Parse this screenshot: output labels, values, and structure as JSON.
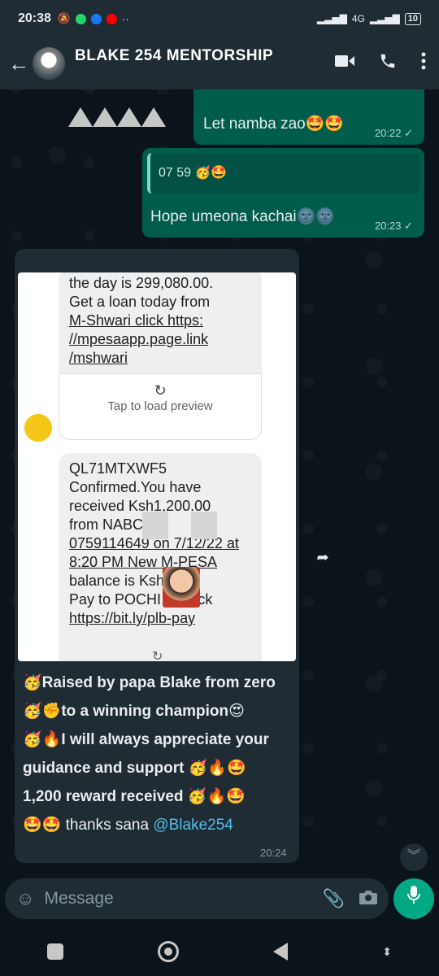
{
  "status_bar": {
    "time": "20:38",
    "network": "4G",
    "battery": "10"
  },
  "header": {
    "title": "BLAKE 254  MENTORSHIP"
  },
  "messages": {
    "out1": {
      "text": "Let namba zao🤩🤩",
      "time": "20:22 ✓"
    },
    "out2": {
      "quote": "07          59 🥳🤩",
      "text": "Hope umeona  kachai🌚🌚",
      "time": "20:23 ✓"
    },
    "in1": {
      "sms1_lines": [
        "the day is 299,080.00.",
        "Get a loan today from",
        "M-Shwari click https:",
        "//mpesaapp.page.link",
        "/mshwari"
      ],
      "preview": "Tap to load preview",
      "sms2_lines": [
        "QL71MTXWF5",
        "Confirmed.You have",
        "received Ksh1,200.00",
        "from NABC",
        "0759114649 on 7/12/22 at",
        "8:20 PM  New M-PESA",
        "balance is Ksh       30.",
        "Pay to POCHI        Y. Click",
        "https://bit.ly/plb-pay"
      ],
      "caption_lines": [
        "🥳Raised by papa Blake from zero",
        "🥳✊to a winning champion😍",
        "🥳🔥I will always appreciate your",
        "guidance and support 🥳🔥🤩",
        "1,200 reward received 🥳🔥🤩"
      ],
      "caption_last": "🤩🤩 thanks sana ",
      "mention": "@Blake254",
      "time": "20:24"
    }
  },
  "input": {
    "placeholder": "Message"
  },
  "colors": {
    "accent": "#00a884",
    "bubble_out": "#005c4b",
    "bubble_in": "#1f2c34",
    "mention": "#53bdeb"
  }
}
